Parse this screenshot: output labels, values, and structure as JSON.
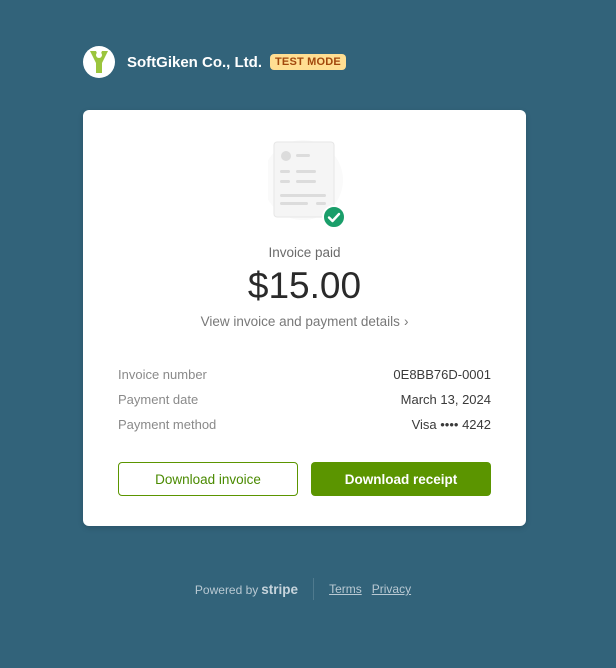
{
  "header": {
    "company": "SoftGiken Co., Ltd.",
    "badge": "TEST MODE",
    "logo_icon": "softgiken-y-logo"
  },
  "card": {
    "status": "Invoice paid",
    "amount": "$15.00",
    "details_link": "View invoice and payment details",
    "details_chevron": "›",
    "rows": [
      {
        "label": "Invoice number",
        "value": "0E8BB76D-0001"
      },
      {
        "label": "Payment date",
        "value": "March 13, 2024"
      },
      {
        "label": "Payment method",
        "value": "Visa •••• 4242"
      }
    ],
    "buttons": {
      "download_invoice": "Download invoice",
      "download_receipt": "Download receipt"
    }
  },
  "footer": {
    "powered_by": "Powered by",
    "stripe": "stripe",
    "terms": "Terms",
    "privacy": "Privacy"
  },
  "colors": {
    "background": "#32637a",
    "accent_green": "#5b9500",
    "badge_bg": "#ffde92",
    "badge_text": "#a2470c",
    "check_green": "#1a9e6a",
    "logo_green": "#9bc53d"
  }
}
